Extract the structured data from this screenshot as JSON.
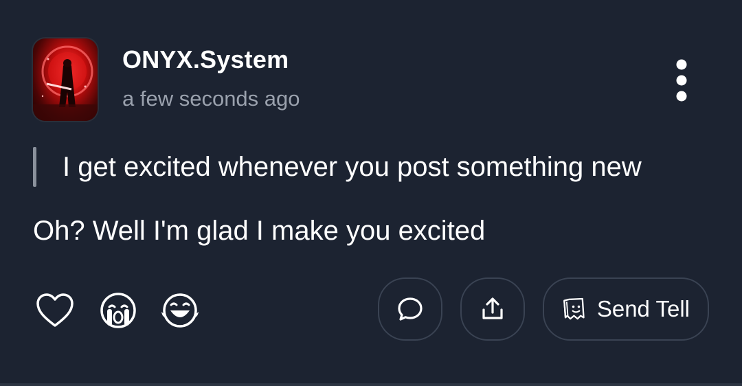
{
  "post": {
    "username": "ONYX.System",
    "timestamp": "a few seconds ago",
    "quote": "I get excited whenever you post something new",
    "reply": "Oh? Well I'm glad I make you excited"
  },
  "actions": {
    "send_tell_label": "Send Tell"
  },
  "icons": {
    "menu": "more-vertical-icon",
    "like": "heart-outline-icon",
    "cry_reaction": "crying-face-icon",
    "laugh_reaction": "tears-of-joy-icon",
    "comment": "speech-bubble-icon",
    "share": "share-upload-icon",
    "tell": "ghost-note-icon"
  },
  "colors": {
    "background": "#1c2331",
    "text_primary": "#ffffff",
    "text_secondary": "#9aa1ad",
    "quote_bar": "#8a919c",
    "button_border": "#3a4353"
  }
}
